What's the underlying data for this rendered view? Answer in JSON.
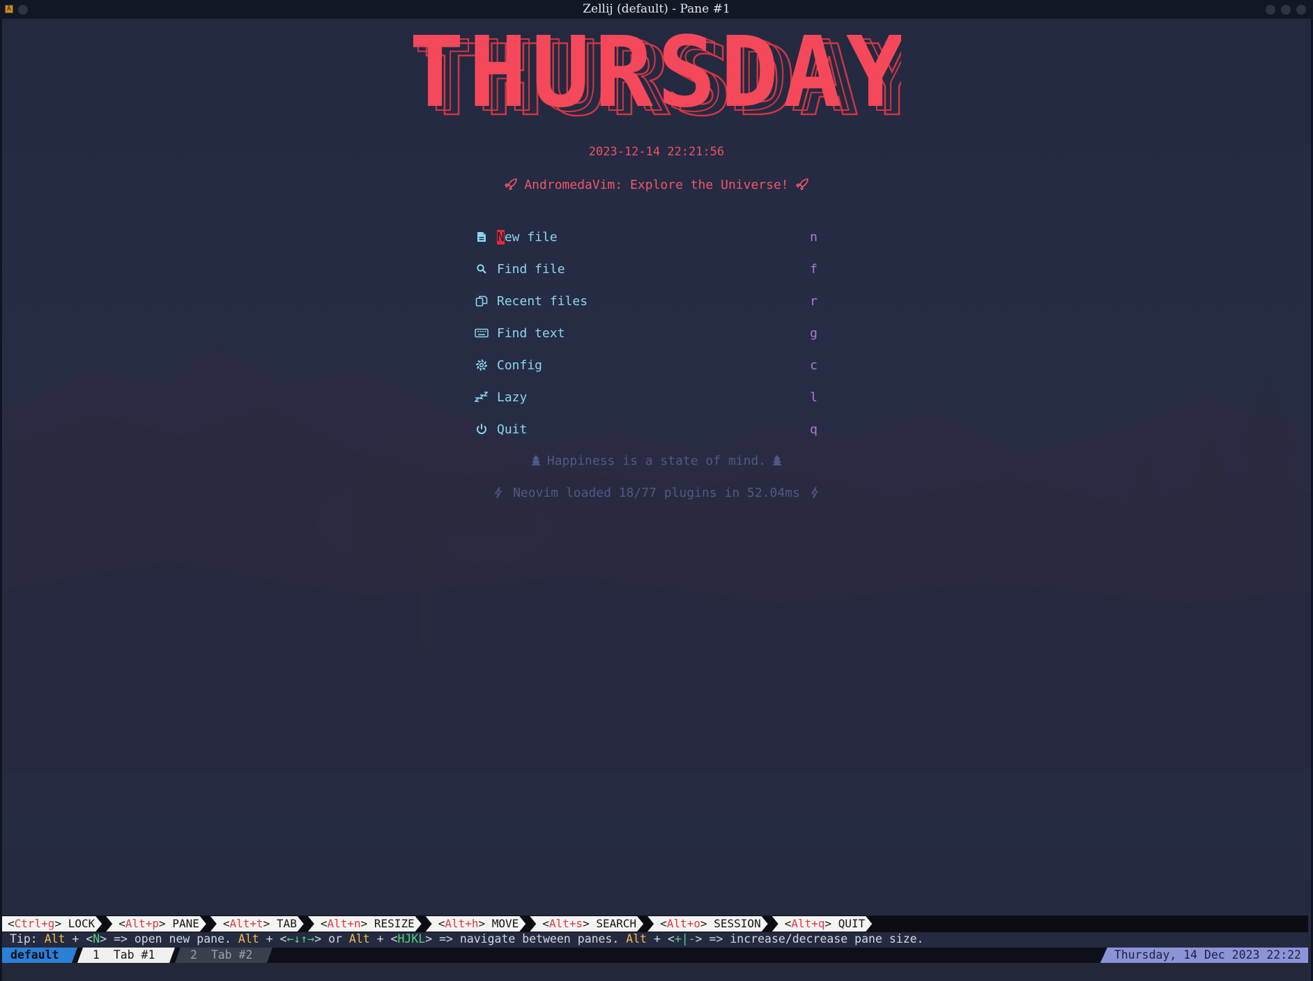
{
  "window": {
    "title": "Zellij (default) - Pane #1",
    "app_icon": "A"
  },
  "dashboard": {
    "banner": "THURSDAY",
    "datetime": "2023-12-14 22:21:56",
    "header": "AndromedaVim: Explore the Universe!",
    "menu": [
      {
        "label": "New file",
        "key": "n",
        "icon": "file-icon"
      },
      {
        "label": "Find file",
        "key": "f",
        "icon": "search-icon"
      },
      {
        "label": "Recent files",
        "key": "r",
        "icon": "copy-icon"
      },
      {
        "label": "Find text",
        "key": "g",
        "icon": "keyboard-icon"
      },
      {
        "label": "Config",
        "key": "c",
        "icon": "gear-icon"
      },
      {
        "label": "Lazy",
        "key": "l",
        "icon": "sleep-icon"
      },
      {
        "label": "Quit",
        "key": "q",
        "icon": "power-icon"
      }
    ],
    "quote": "Happiness is a state of mind.",
    "startup": "Neovim loaded 18/77 plugins in 52.04ms"
  },
  "zellij": {
    "keybinds": [
      {
        "key": "Ctrl+g",
        "action": "LOCK"
      },
      {
        "key": "Alt+p",
        "action": "PANE"
      },
      {
        "key": "Alt+t",
        "action": "TAB"
      },
      {
        "key": "Alt+n",
        "action": "RESIZE"
      },
      {
        "key": "Alt+h",
        "action": "MOVE"
      },
      {
        "key": "Alt+s",
        "action": "SEARCH"
      },
      {
        "key": "Alt+o",
        "action": "SESSION"
      },
      {
        "key": "Alt+q",
        "action": "QUIT"
      }
    ],
    "tip": {
      "prefix": "Tip:",
      "alt": "Alt",
      "plus": "+",
      "new_pane_key": "N",
      "new_pane_text": "=> open new pane.",
      "arrows": "←↓↑→",
      "or": "or",
      "hjkl": "HJKL",
      "navigate_text": "=> navigate between panes.",
      "resize_keys": "+|-",
      "resize_text": "=> increase/decrease pane size."
    },
    "session_name": "default",
    "tabs": [
      {
        "index": "1",
        "name": "Tab #1",
        "active": true
      },
      {
        "index": "2",
        "name": "Tab #2",
        "active": false
      }
    ],
    "clock": "Thursday, 14 Dec 2023 22:22"
  },
  "colors": {
    "accent_red": "#f25667",
    "menu_cyan": "#8ad7f0",
    "key_purple": "#b17ad8",
    "footer_blue": "#4e5a86",
    "session_blue": "#2a7fd6",
    "clock_purple": "#8c94d8"
  }
}
